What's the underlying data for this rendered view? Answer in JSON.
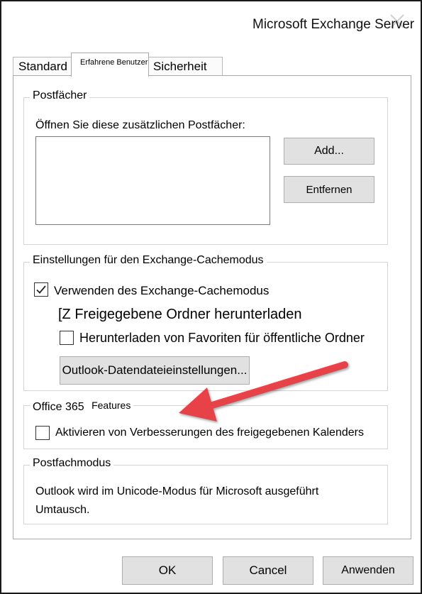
{
  "window": {
    "title": "Microsoft Exchange Server",
    "close_icon": "close-icon"
  },
  "tabs": [
    {
      "label": "Standard"
    },
    {
      "label": "Erfahrene Benutzer",
      "selected": true
    },
    {
      "label": "Sicherheit"
    }
  ],
  "mailboxes": {
    "legend": "Postfächer",
    "prompt": "Öffnen Sie diese zusätzlichen Postfächer:",
    "add_label": "Add...",
    "remove_label": "Entfernen"
  },
  "cache": {
    "legend": "Einstellungen für den Exchange-Cachemodus",
    "use_cache_label": "Verwenden des Exchange-Cachemodus",
    "use_cache_checked": true,
    "shared_folders_label": "[Z Freigegebene Ordner herunterladen",
    "favorites_label": "Herunterladen von Favoriten für öffentliche Ordner",
    "favorites_checked": false,
    "datafile_button": "Outlook-Datendateieinstellungen..."
  },
  "office365": {
    "legend_main": "Office 365",
    "legend_features": "Features",
    "calendar_label": "Aktivieren von Verbesserungen des freigegebenen Kalenders",
    "calendar_checked": false
  },
  "mailbox_mode": {
    "legend": "Postfachmodus",
    "line1": "Outlook wird im Unicode-Modus für Microsoft ausgeführt",
    "line2": "Umtausch."
  },
  "footer": {
    "ok_label": "OK",
    "cancel_label": "Cancel",
    "apply_label": "Anwenden"
  },
  "colors": {
    "arrow": "#e8424a",
    "button_face": "#e1e1e1"
  }
}
